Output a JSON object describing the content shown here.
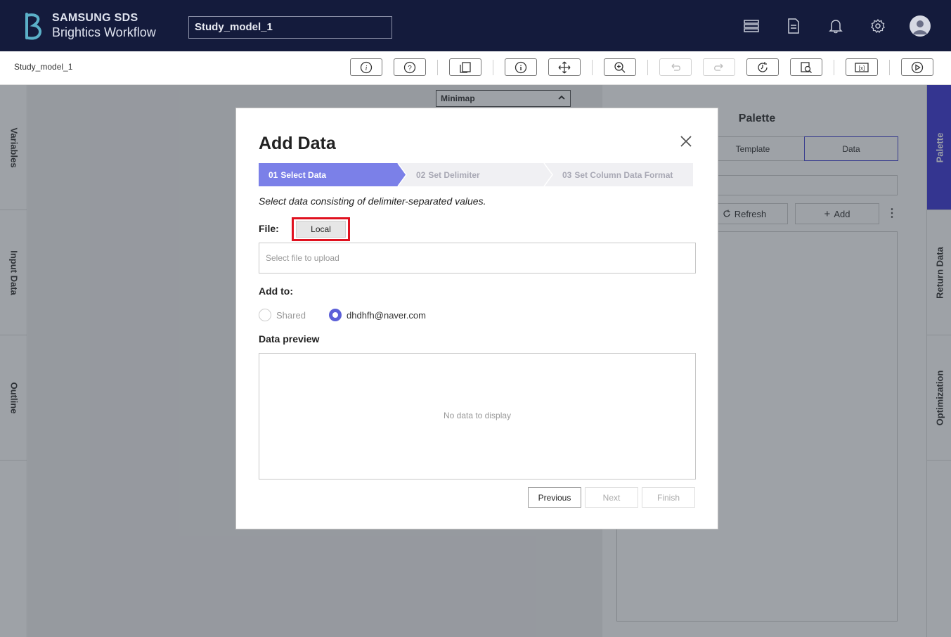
{
  "app": {
    "brand_line1": "SAMSUNG SDS",
    "brand_line2": "Brightics Workflow",
    "model_name": "Study_model_1"
  },
  "header_icons": [
    "data-storage-icon",
    "document-icon",
    "bell-icon",
    "gear-icon",
    "user-avatar-icon"
  ],
  "toolbar": {
    "breadcrumb": "Study_model_1",
    "buttons": [
      "info-icon",
      "help-icon",
      "copy-icon",
      "info-icon",
      "move-icon",
      "zoom-in-icon",
      "undo-icon",
      "redo-icon",
      "history-icon",
      "search-document-icon",
      "variable-icon",
      "run-icon"
    ]
  },
  "left_tabs": [
    "Variables",
    "Input Data",
    "Outline"
  ],
  "right_tabs": [
    "Palette",
    "Return Data",
    "Optimization"
  ],
  "minimap": {
    "label": "Minimap"
  },
  "palette": {
    "title": "Palette",
    "tabs": [
      "Template",
      "Data"
    ],
    "refresh_label": "Refresh",
    "add_label": "Add"
  },
  "modal": {
    "title": "Add Data",
    "steps": [
      {
        "num": "01",
        "label": "Select Data",
        "state": "active"
      },
      {
        "num": "02",
        "label": "Set Delimiter",
        "state": "inactive"
      },
      {
        "num": "03",
        "label": "Set Column Data Format",
        "state": "inactive"
      }
    ],
    "instruction": "Select data consisting of delimiter-separated values.",
    "file_label": "File:",
    "local_button": "Local",
    "file_placeholder": "Select file to upload",
    "add_to_label": "Add to:",
    "radio_options": [
      {
        "label": "Shared",
        "checked": false
      },
      {
        "label": "dhdhfh@naver.com",
        "checked": true
      }
    ],
    "preview_label": "Data preview",
    "preview_empty": "No data to display",
    "footer": {
      "previous": "Previous",
      "next": "Next",
      "finish": "Finish"
    }
  },
  "colors": {
    "header_bg": "#141b3c",
    "accent": "#3f3ad6",
    "step_active": "#7b80e8",
    "highlight": "#e0111f"
  }
}
